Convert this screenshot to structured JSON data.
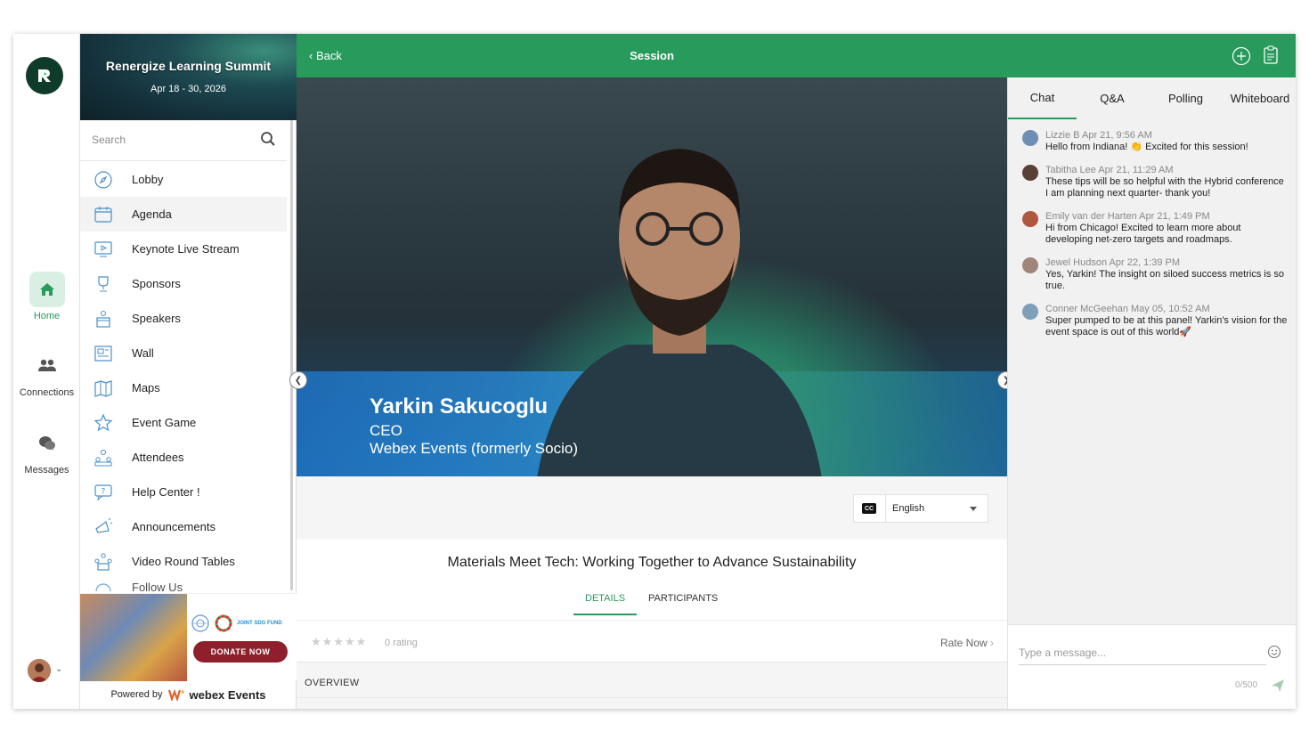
{
  "rail": {
    "items": [
      {
        "label": "Home",
        "icon": "home-icon"
      },
      {
        "label": "Connections",
        "icon": "people-icon"
      },
      {
        "label": "Messages",
        "icon": "chat-bubbles-icon"
      }
    ]
  },
  "event": {
    "title": "Renergize Learning Summit",
    "dates": "Apr 18 - 30, 2026"
  },
  "search": {
    "placeholder": "Search"
  },
  "menu": [
    {
      "label": "Lobby",
      "icon": "compass-icon"
    },
    {
      "label": "Agenda",
      "icon": "calendar-icon"
    },
    {
      "label": "Keynote Live Stream",
      "icon": "video-screen-icon"
    },
    {
      "label": "Sponsors",
      "icon": "trophy-icon"
    },
    {
      "label": "Speakers",
      "icon": "speaker-podium-icon"
    },
    {
      "label": "Wall",
      "icon": "wall-newspaper-icon"
    },
    {
      "label": "Maps",
      "icon": "map-icon"
    },
    {
      "label": "Event Game",
      "icon": "star-icon"
    },
    {
      "label": "Attendees",
      "icon": "attendees-icon"
    },
    {
      "label": "Help Center !",
      "icon": "help-chat-icon"
    },
    {
      "label": "Announcements",
      "icon": "megaphone-icon"
    },
    {
      "label": "Video Round Tables",
      "icon": "round-table-icon"
    },
    {
      "label": "Follow Us",
      "icon": "follow-icon"
    }
  ],
  "ad": {
    "joint_label": "JOINT SDG FUND",
    "donate_label": "DONATE NOW"
  },
  "powered": {
    "prefix": "Powered by",
    "brand": "webex Events"
  },
  "topbar": {
    "back_label": "Back",
    "title": "Session"
  },
  "video": {
    "speaker_name": "Yarkin Sakucoglu",
    "speaker_role": "CEO",
    "speaker_org": "Webex Events (formerly Socio)"
  },
  "captions": {
    "cc_label": "CC",
    "language": "English"
  },
  "session": {
    "title": "Materials Meet Tech: Working Together to Advance Sustainability",
    "tabs": [
      "DETAILS",
      "PARTICIPANTS"
    ],
    "active_tab": "DETAILS",
    "rating_text": "0 rating",
    "rating_value": 0,
    "rating_max": 5,
    "rate_now_label": "Rate Now",
    "overview_label": "OVERVIEW"
  },
  "chat": {
    "tabs": [
      "Chat",
      "Q&A",
      "Polling",
      "Whiteboard"
    ],
    "active_tab": "Chat",
    "messages": [
      {
        "author": "Lizzie B",
        "time": "Apr 21, 9:56 AM",
        "text": "Hello from Indiana! 👏 Excited for this session!"
      },
      {
        "author": "Tabitha Lee",
        "time": "Apr 21, 11:29 AM",
        "text": "These tips will be so helpful with the Hybrid conference I am planning next quarter- thank you!"
      },
      {
        "author": "Emily van der Harten",
        "time": "Apr 21, 1:49 PM",
        "text": "Hi from Chicago! Excited to learn more about developing net-zero targets and roadmaps."
      },
      {
        "author": "Jewel Hudson",
        "time": "Apr 22, 1:39 PM",
        "text": "Yes, Yarkin! The insight on siloed success metrics is so true."
      },
      {
        "author": "Conner McGeehan",
        "time": "May 05, 10:52 AM",
        "text": "Super pumped to be at this panel! Yarkin's vision for the event space is out of this world🚀"
      }
    ],
    "input_placeholder": "Type a message...",
    "char_count": "0/500"
  },
  "colors": {
    "brand": "#279a5c",
    "brand_dark": "#0f3b2b",
    "donate": "#8f1f2b"
  }
}
